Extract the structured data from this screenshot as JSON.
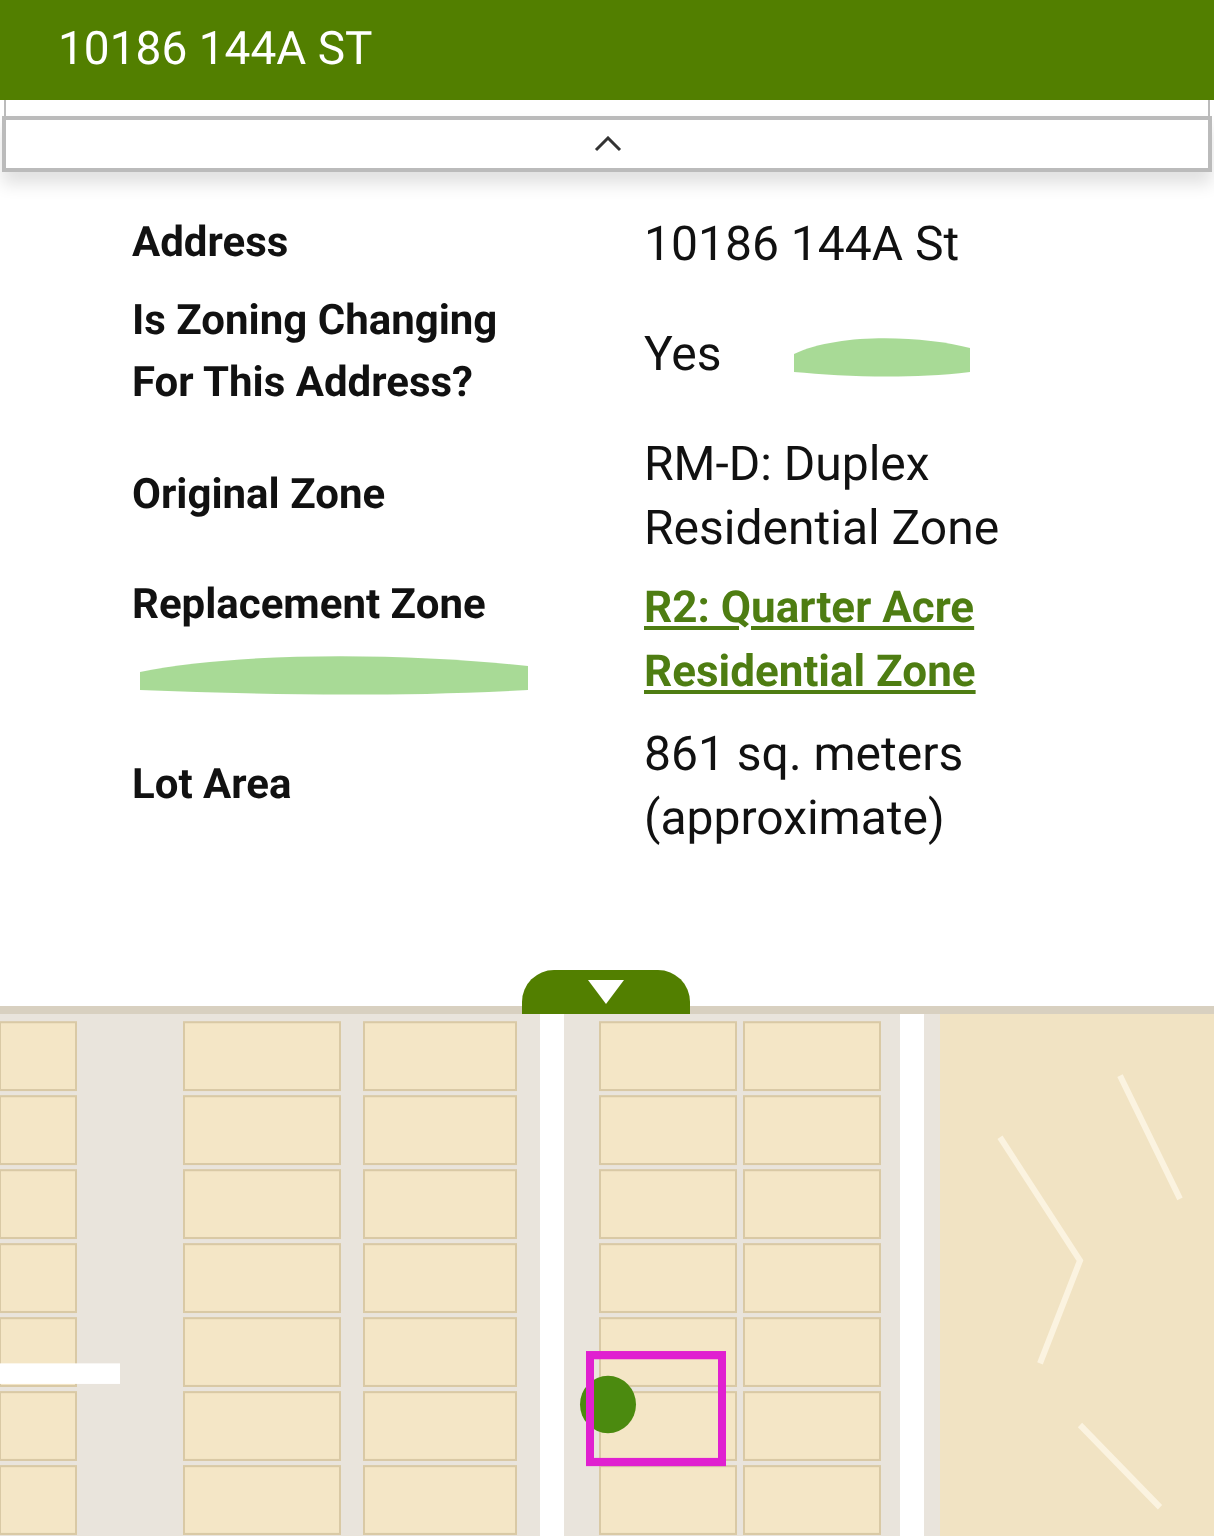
{
  "header": {
    "title": "10186 144A ST"
  },
  "details": [
    {
      "label": "Address",
      "value": "10186 144A St",
      "kind": "text"
    },
    {
      "label": "Is Zoning Changing For This Address?",
      "value": "Yes",
      "kind": "text"
    },
    {
      "label": "Original Zone",
      "value": "RM-D: Duplex Residential Zone",
      "kind": "text"
    },
    {
      "label": "Replacement Zone",
      "value": "R2: Quarter Acre Residential Zone",
      "kind": "link"
    },
    {
      "label": "Lot Area",
      "value": "861 sq. meters (approximate)",
      "kind": "text"
    }
  ]
}
